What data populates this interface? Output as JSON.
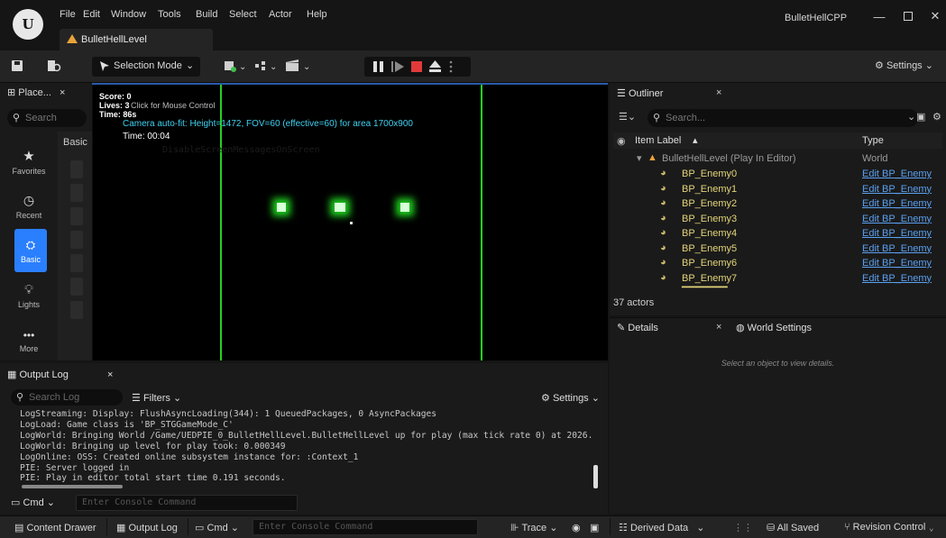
{
  "app": {
    "project_name": "BulletHellCPP",
    "level_tab": "BulletHellLevel",
    "menu": [
      "File",
      "Edit",
      "Window",
      "Tools",
      "Build",
      "Select",
      "Actor",
      "Help"
    ]
  },
  "toolbar": {
    "selection_mode": "Selection Mode",
    "settings": "Settings"
  },
  "place_panel": {
    "tab_label": "Place...",
    "search_placeholder": "Search",
    "basic_header": "Basic",
    "categories": [
      "Favorites",
      "Recent",
      "Basic",
      "Lights",
      "More"
    ]
  },
  "viewport": {
    "score": "Score: 0",
    "lives": "Lives: 3",
    "click_hint": "Click for Mouse Control",
    "time_short": "Time: 86s",
    "camera_info": "Camera auto-fit: Height=1472, FOV=60 (effective=60) for area 1700x900",
    "time_main": "Time: 00:04",
    "ghost_text": "DisableScreenMessagesOnScreen"
  },
  "outliner": {
    "tab_label": "Outliner",
    "search_placeholder": "Search...",
    "col_label": "Item Label",
    "col_type": "Type",
    "root_label": "BulletHellLevel (Play In Editor)",
    "root_type": "World",
    "items": [
      {
        "name": "BP_Enemy0",
        "type": "Edit BP_Enemy"
      },
      {
        "name": "BP_Enemy1",
        "type": "Edit BP_Enemy"
      },
      {
        "name": "BP_Enemy2",
        "type": "Edit BP_Enemy"
      },
      {
        "name": "BP_Enemy3",
        "type": "Edit BP_Enemy"
      },
      {
        "name": "BP_Enemy4",
        "type": "Edit BP_Enemy"
      },
      {
        "name": "BP_Enemy5",
        "type": "Edit BP_Enemy"
      },
      {
        "name": "BP_Enemy6",
        "type": "Edit BP_Enemy"
      },
      {
        "name": "BP_Enemy7",
        "type": "Edit BP_Enemy"
      }
    ],
    "actor_count": "37 actors"
  },
  "details": {
    "tab_label": "Details",
    "world_settings": "World Settings",
    "empty_message": "Select an object to view details."
  },
  "output_log": {
    "tab_label": "Output Log",
    "search_placeholder": "Search Log",
    "filters": "Filters",
    "settings": "Settings",
    "lines": [
      "LogStreaming: Display: FlushAsyncLoading(344): 1 QueuedPackages, 0 AsyncPackages",
      "LogLoad: Game class is 'BP_STGGameMode_C'",
      "LogWorld: Bringing World /Game/UEDPIE_0_BulletHellLevel.BulletHellLevel up for play (max tick rate 0) at 2026.",
      "LogWorld: Bringing up level for play took: 0.000349",
      "LogOnline: OSS: Created online subsystem instance for: :Context_1",
      "PIE: Server logged in",
      "PIE: Play in editor total start time 0.191 seconds."
    ],
    "cmd_label": "Cmd",
    "cmd_placeholder": "Enter Console Command"
  },
  "statusbar": {
    "content_drawer": "Content Drawer",
    "output_log": "Output Log",
    "cmd": "Cmd",
    "cmd_placeholder": "Enter Console Command",
    "trace": "Trace",
    "derived_data": "Derived Data",
    "all_saved": "All Saved",
    "revision_control": "Revision Control"
  }
}
